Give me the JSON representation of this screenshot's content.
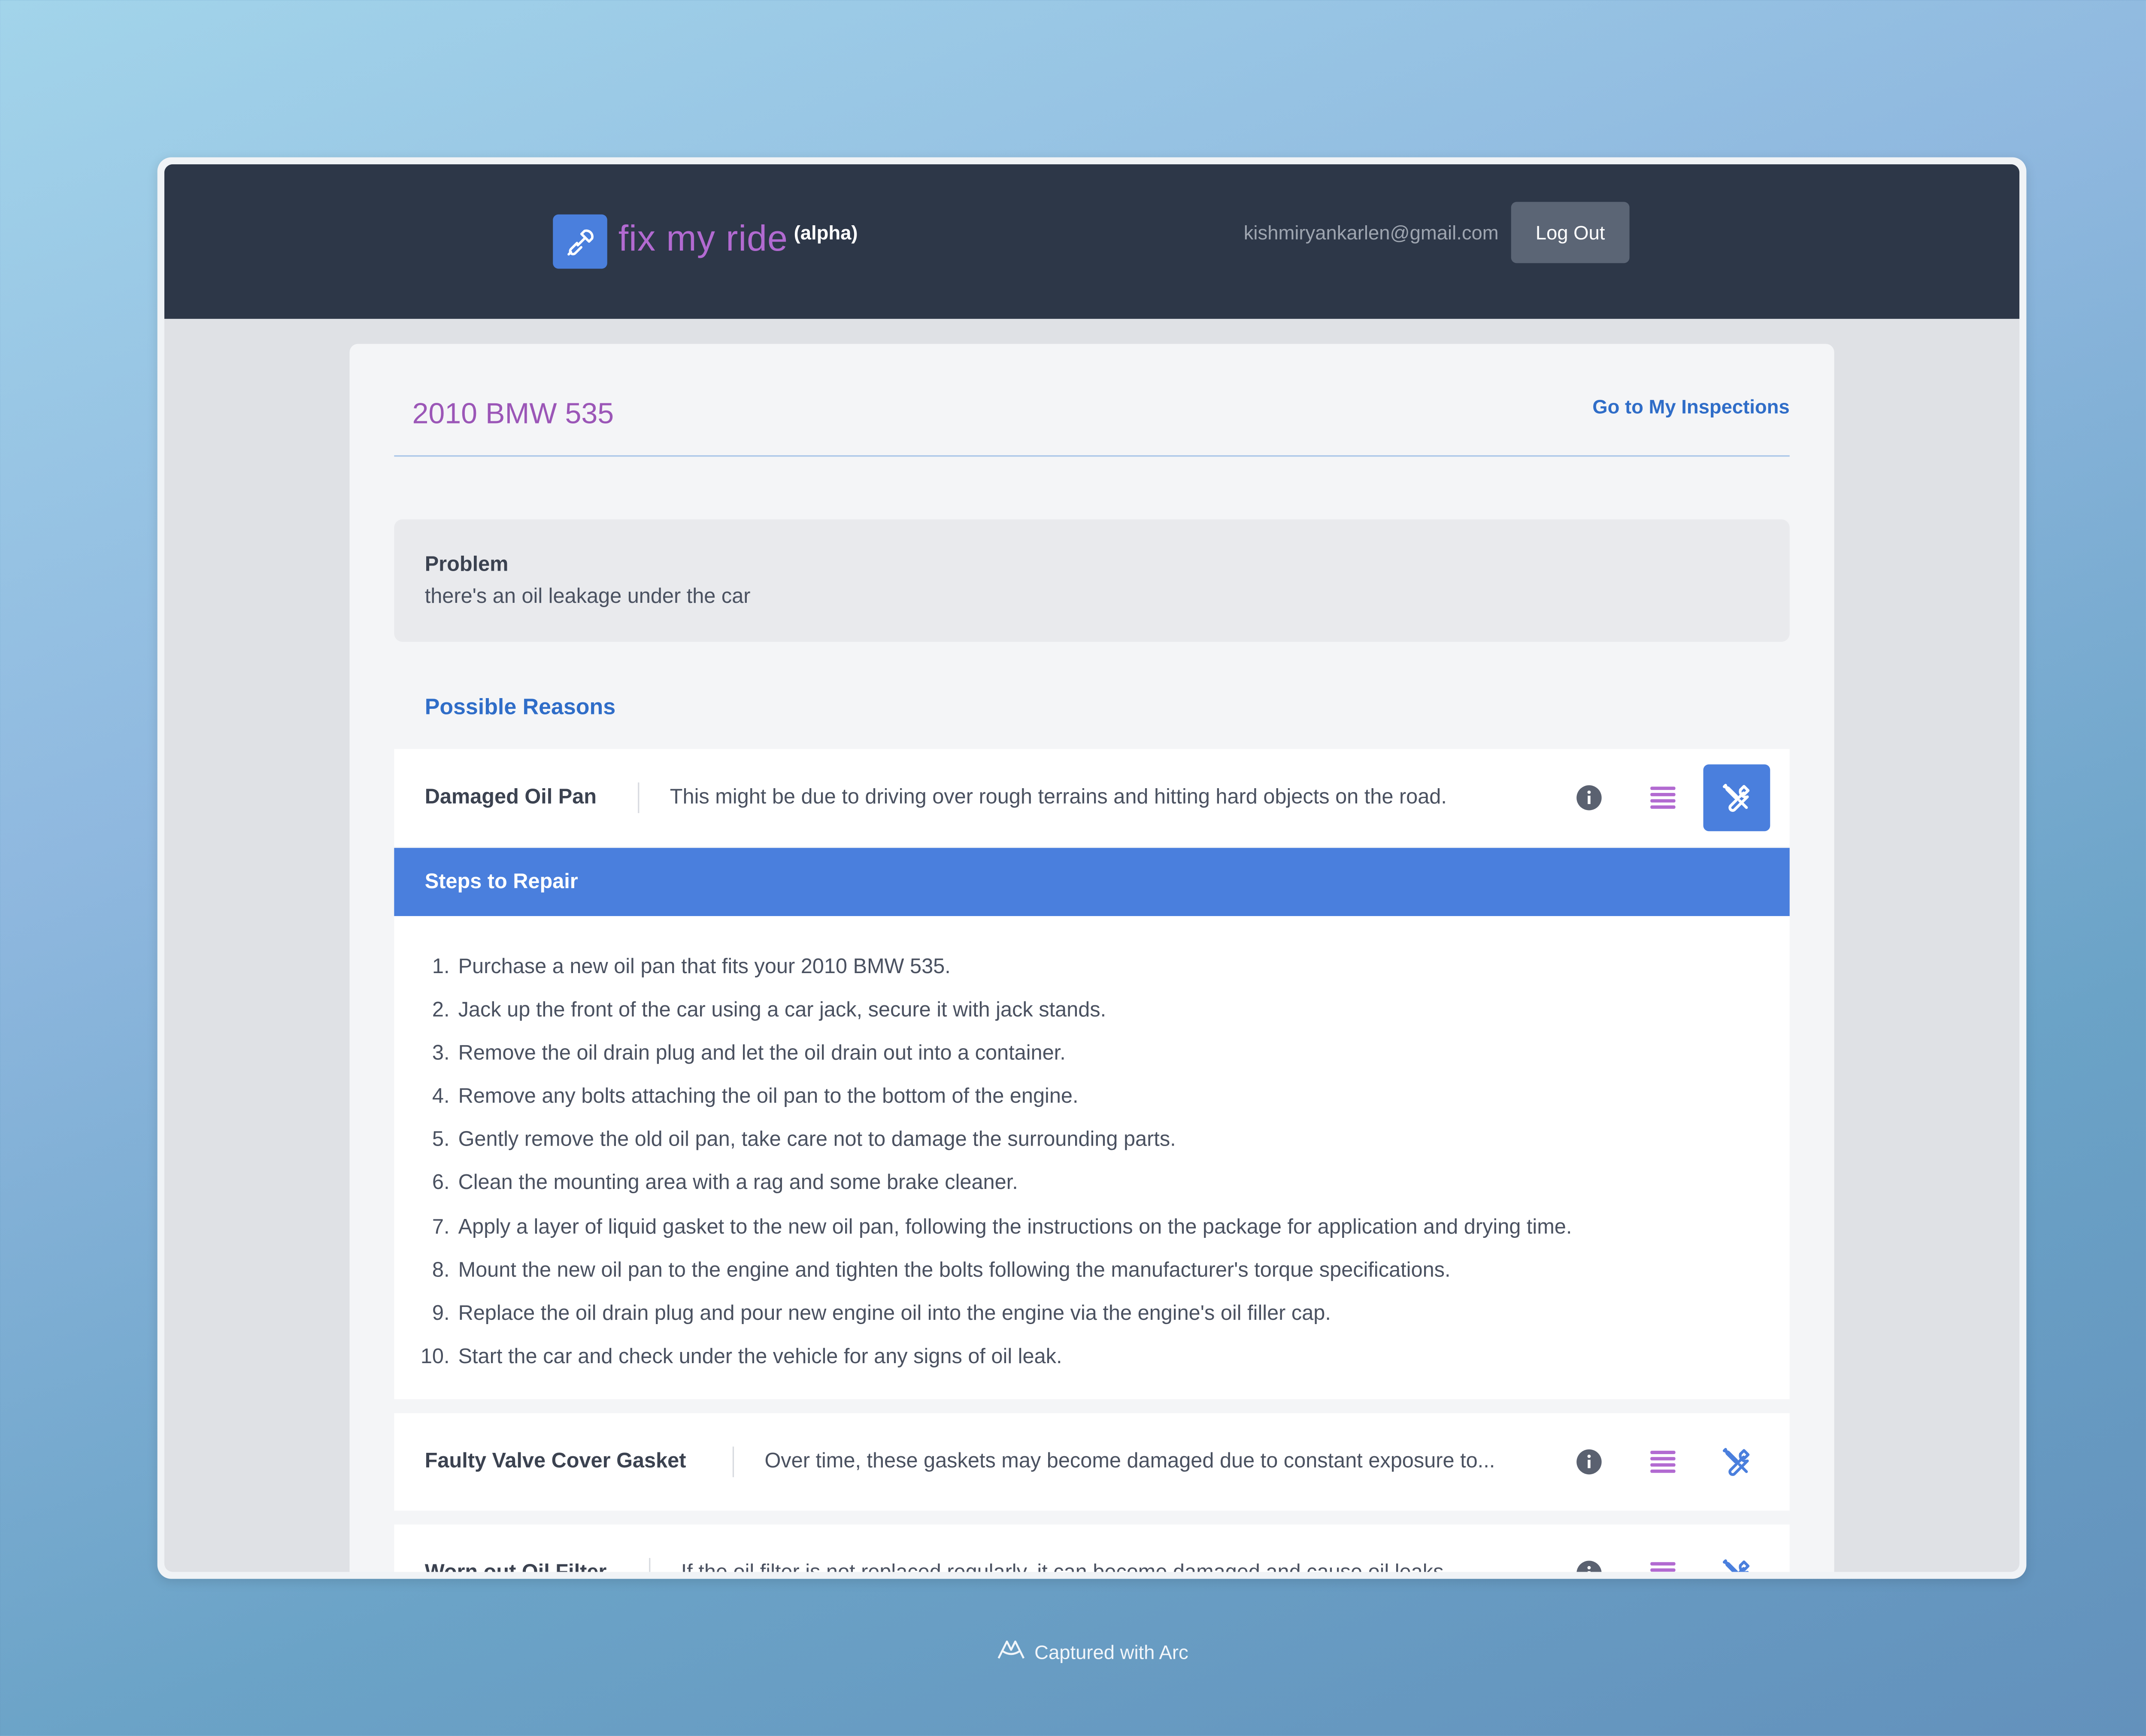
{
  "navbar": {
    "brand": "fix my ride",
    "badge": "(alpha)",
    "user_email": "kishmiryankarlen@gmail.com",
    "logout_label": "Log Out"
  },
  "page": {
    "title": "2010 BMW 535",
    "goto_link": "Go to My Inspections"
  },
  "problem": {
    "label": "Problem",
    "text": "there's an oil leakage under the car"
  },
  "reasons_label": "Possible Reasons",
  "reasons": [
    {
      "name": "Damaged Oil Pan",
      "description": "This might be due to driving over rough terrains and hitting hard objects on the road."
    },
    {
      "name": "Faulty Valve Cover Gasket",
      "description": "Over time, these gaskets may become damaged due to constant exposure to..."
    },
    {
      "name": "Worn out Oil Filter",
      "description": "If the oil filter is not replaced regularly, it can become damaged and cause oil leaks..."
    }
  ],
  "steps_header": "Steps to Repair",
  "steps": [
    "Purchase a new oil pan that fits your 2010 BMW 535.",
    "Jack up the front of the car using a car jack, secure it with jack stands.",
    "Remove the oil drain plug and let the oil drain out into a container.",
    "Remove any bolts attaching the oil pan to the bottom of the engine.",
    "Gently remove the old oil pan, take care not to damage the surrounding parts.",
    "Clean the mounting area with a rag and some brake cleaner.",
    "Apply a layer of liquid gasket to the new oil pan, following the instructions on the package for application and drying time.",
    "Mount the new oil pan to the engine and tighten the bolts following the manufacturer's torque specifications.",
    "Replace the oil drain plug and pour new engine oil into the engine via the engine's oil filler cap.",
    "Start the car and check under the vehicle for any signs of oil leak."
  ],
  "footer": {
    "capture_text": "Captured with Arc"
  },
  "colors": {
    "accent_blue": "#4a7fdd",
    "brand_purple": "#b26ad1",
    "navbar_bg": "#2d3748"
  },
  "icons": {
    "logo": "wrench-plug-icon",
    "info": "info-icon",
    "list": "list-icon",
    "repair": "tools-icon",
    "arc": "arc-logo-icon"
  }
}
